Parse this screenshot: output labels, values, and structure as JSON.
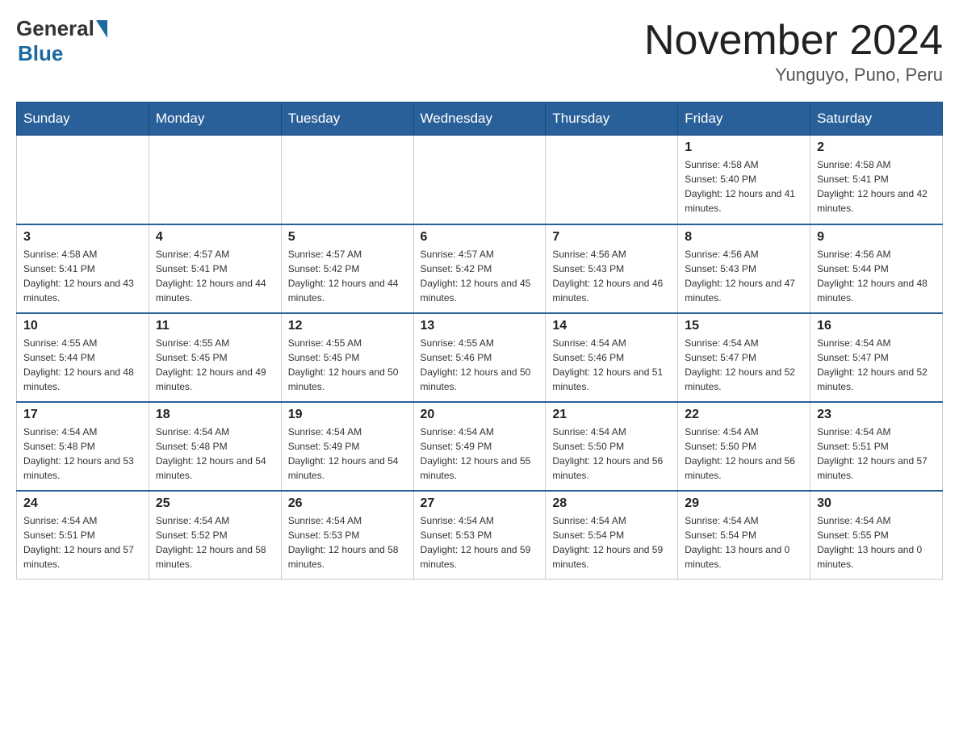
{
  "header": {
    "logo_general": "General",
    "logo_blue": "Blue",
    "month_title": "November 2024",
    "subtitle": "Yunguyo, Puno, Peru"
  },
  "weekdays": [
    "Sunday",
    "Monday",
    "Tuesday",
    "Wednesday",
    "Thursday",
    "Friday",
    "Saturday"
  ],
  "weeks": [
    [
      {
        "day": "",
        "sunrise": "",
        "sunset": "",
        "daylight": ""
      },
      {
        "day": "",
        "sunrise": "",
        "sunset": "",
        "daylight": ""
      },
      {
        "day": "",
        "sunrise": "",
        "sunset": "",
        "daylight": ""
      },
      {
        "day": "",
        "sunrise": "",
        "sunset": "",
        "daylight": ""
      },
      {
        "day": "",
        "sunrise": "",
        "sunset": "",
        "daylight": ""
      },
      {
        "day": "1",
        "sunrise": "Sunrise: 4:58 AM",
        "sunset": "Sunset: 5:40 PM",
        "daylight": "Daylight: 12 hours and 41 minutes."
      },
      {
        "day": "2",
        "sunrise": "Sunrise: 4:58 AM",
        "sunset": "Sunset: 5:41 PM",
        "daylight": "Daylight: 12 hours and 42 minutes."
      }
    ],
    [
      {
        "day": "3",
        "sunrise": "Sunrise: 4:58 AM",
        "sunset": "Sunset: 5:41 PM",
        "daylight": "Daylight: 12 hours and 43 minutes."
      },
      {
        "day": "4",
        "sunrise": "Sunrise: 4:57 AM",
        "sunset": "Sunset: 5:41 PM",
        "daylight": "Daylight: 12 hours and 44 minutes."
      },
      {
        "day": "5",
        "sunrise": "Sunrise: 4:57 AM",
        "sunset": "Sunset: 5:42 PM",
        "daylight": "Daylight: 12 hours and 44 minutes."
      },
      {
        "day": "6",
        "sunrise": "Sunrise: 4:57 AM",
        "sunset": "Sunset: 5:42 PM",
        "daylight": "Daylight: 12 hours and 45 minutes."
      },
      {
        "day": "7",
        "sunrise": "Sunrise: 4:56 AM",
        "sunset": "Sunset: 5:43 PM",
        "daylight": "Daylight: 12 hours and 46 minutes."
      },
      {
        "day": "8",
        "sunrise": "Sunrise: 4:56 AM",
        "sunset": "Sunset: 5:43 PM",
        "daylight": "Daylight: 12 hours and 47 minutes."
      },
      {
        "day": "9",
        "sunrise": "Sunrise: 4:56 AM",
        "sunset": "Sunset: 5:44 PM",
        "daylight": "Daylight: 12 hours and 48 minutes."
      }
    ],
    [
      {
        "day": "10",
        "sunrise": "Sunrise: 4:55 AM",
        "sunset": "Sunset: 5:44 PM",
        "daylight": "Daylight: 12 hours and 48 minutes."
      },
      {
        "day": "11",
        "sunrise": "Sunrise: 4:55 AM",
        "sunset": "Sunset: 5:45 PM",
        "daylight": "Daylight: 12 hours and 49 minutes."
      },
      {
        "day": "12",
        "sunrise": "Sunrise: 4:55 AM",
        "sunset": "Sunset: 5:45 PM",
        "daylight": "Daylight: 12 hours and 50 minutes."
      },
      {
        "day": "13",
        "sunrise": "Sunrise: 4:55 AM",
        "sunset": "Sunset: 5:46 PM",
        "daylight": "Daylight: 12 hours and 50 minutes."
      },
      {
        "day": "14",
        "sunrise": "Sunrise: 4:54 AM",
        "sunset": "Sunset: 5:46 PM",
        "daylight": "Daylight: 12 hours and 51 minutes."
      },
      {
        "day": "15",
        "sunrise": "Sunrise: 4:54 AM",
        "sunset": "Sunset: 5:47 PM",
        "daylight": "Daylight: 12 hours and 52 minutes."
      },
      {
        "day": "16",
        "sunrise": "Sunrise: 4:54 AM",
        "sunset": "Sunset: 5:47 PM",
        "daylight": "Daylight: 12 hours and 52 minutes."
      }
    ],
    [
      {
        "day": "17",
        "sunrise": "Sunrise: 4:54 AM",
        "sunset": "Sunset: 5:48 PM",
        "daylight": "Daylight: 12 hours and 53 minutes."
      },
      {
        "day": "18",
        "sunrise": "Sunrise: 4:54 AM",
        "sunset": "Sunset: 5:48 PM",
        "daylight": "Daylight: 12 hours and 54 minutes."
      },
      {
        "day": "19",
        "sunrise": "Sunrise: 4:54 AM",
        "sunset": "Sunset: 5:49 PM",
        "daylight": "Daylight: 12 hours and 54 minutes."
      },
      {
        "day": "20",
        "sunrise": "Sunrise: 4:54 AM",
        "sunset": "Sunset: 5:49 PM",
        "daylight": "Daylight: 12 hours and 55 minutes."
      },
      {
        "day": "21",
        "sunrise": "Sunrise: 4:54 AM",
        "sunset": "Sunset: 5:50 PM",
        "daylight": "Daylight: 12 hours and 56 minutes."
      },
      {
        "day": "22",
        "sunrise": "Sunrise: 4:54 AM",
        "sunset": "Sunset: 5:50 PM",
        "daylight": "Daylight: 12 hours and 56 minutes."
      },
      {
        "day": "23",
        "sunrise": "Sunrise: 4:54 AM",
        "sunset": "Sunset: 5:51 PM",
        "daylight": "Daylight: 12 hours and 57 minutes."
      }
    ],
    [
      {
        "day": "24",
        "sunrise": "Sunrise: 4:54 AM",
        "sunset": "Sunset: 5:51 PM",
        "daylight": "Daylight: 12 hours and 57 minutes."
      },
      {
        "day": "25",
        "sunrise": "Sunrise: 4:54 AM",
        "sunset": "Sunset: 5:52 PM",
        "daylight": "Daylight: 12 hours and 58 minutes."
      },
      {
        "day": "26",
        "sunrise": "Sunrise: 4:54 AM",
        "sunset": "Sunset: 5:53 PM",
        "daylight": "Daylight: 12 hours and 58 minutes."
      },
      {
        "day": "27",
        "sunrise": "Sunrise: 4:54 AM",
        "sunset": "Sunset: 5:53 PM",
        "daylight": "Daylight: 12 hours and 59 minutes."
      },
      {
        "day": "28",
        "sunrise": "Sunrise: 4:54 AM",
        "sunset": "Sunset: 5:54 PM",
        "daylight": "Daylight: 12 hours and 59 minutes."
      },
      {
        "day": "29",
        "sunrise": "Sunrise: 4:54 AM",
        "sunset": "Sunset: 5:54 PM",
        "daylight": "Daylight: 13 hours and 0 minutes."
      },
      {
        "day": "30",
        "sunrise": "Sunrise: 4:54 AM",
        "sunset": "Sunset: 5:55 PM",
        "daylight": "Daylight: 13 hours and 0 minutes."
      }
    ]
  ]
}
